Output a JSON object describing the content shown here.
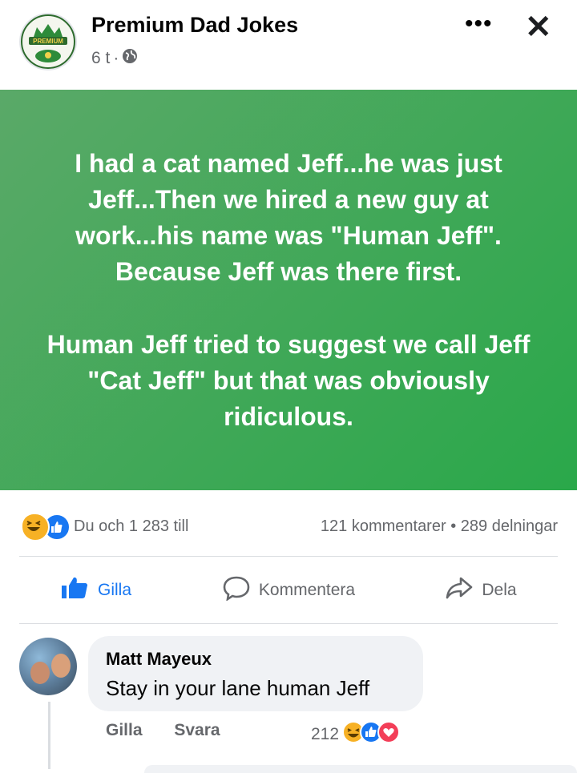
{
  "header": {
    "page_name": "Premium Dad Jokes",
    "time": "6 t",
    "dot": "·",
    "more_icon": "•••",
    "close_icon": "✕"
  },
  "post": {
    "paragraph1": "I had a cat named Jeff...he was just Jeff...Then we hired a new guy at work...his name was \"Human Jeff\". Because Jeff was there first.",
    "paragraph2": "Human Jeff tried to suggest we call Jeff \"Cat Jeff\" but that was obviously ridiculous.",
    "bg_start": "#5aa968",
    "bg_end": "#2aa84a"
  },
  "stats": {
    "reactions_text": "Du och 1 283 till",
    "comments": "121 kommentarer",
    "sep": "•",
    "shares": "289 delningar"
  },
  "actions": {
    "like": "Gilla",
    "comment": "Kommentera",
    "share": "Dela"
  },
  "comment": {
    "author": "Matt Mayeux",
    "text": "Stay in your lane human Jeff",
    "like": "Gilla",
    "reply": "Svara",
    "reaction_count": "212"
  },
  "colors": {
    "accent": "#1877f2",
    "secondary_text": "#65676b"
  }
}
